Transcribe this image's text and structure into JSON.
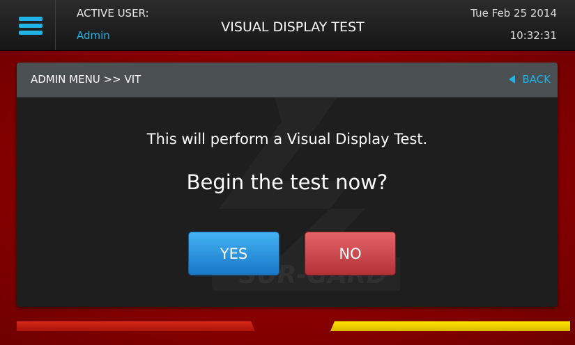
{
  "header": {
    "menu_icon": "hamburger-menu-icon",
    "active_user_label": "ACTIVE USER:",
    "active_user_name": "Admin",
    "title": "VISUAL DISPLAY TEST",
    "date": "Tue Feb 25 2014",
    "time": "10:32:31"
  },
  "panel": {
    "breadcrumb": "ADMIN MENU >> VIT",
    "back_label": "BACK",
    "back_icon": "triangle-left-icon",
    "message": "This will perform a Visual Display Test.",
    "question": "Begin the test now?",
    "yes_label": "YES",
    "no_label": "NO",
    "watermark_text": "SUR-GARD"
  },
  "colors": {
    "accent": "#1fb3e8",
    "background": "#8a0000",
    "yes_button": "#2a93de",
    "no_button": "#cc4146",
    "stripe_left": "#c81f12",
    "stripe_right": "#f2d000"
  }
}
